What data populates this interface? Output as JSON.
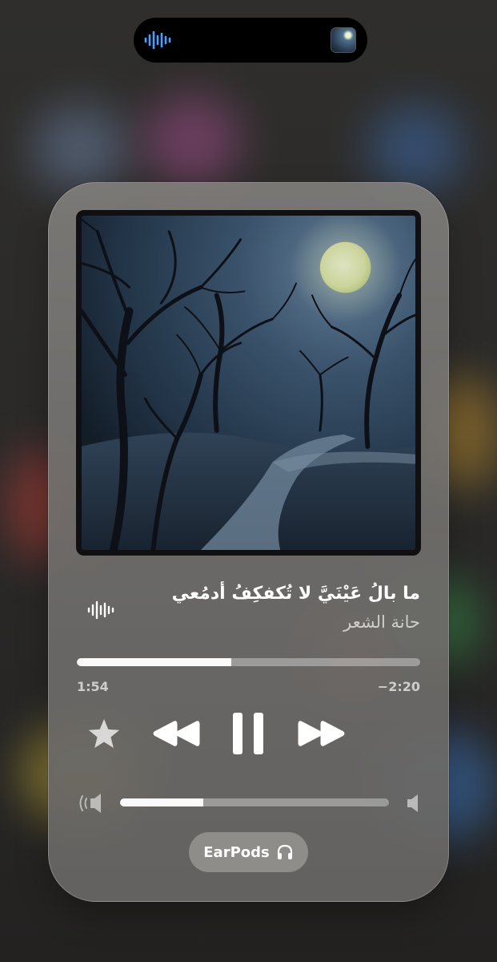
{
  "now_playing": {
    "title": "ما بالُ عَيْنَيَّ لا تُكفكِفُ أدمُعي",
    "artist": "حانة الشعر"
  },
  "playback": {
    "elapsed": "1:54",
    "remaining": "−2:20",
    "progress_fraction": 0.45,
    "is_playing": true
  },
  "volume": {
    "level_fraction": 0.31
  },
  "output": {
    "device_label": "EarPods",
    "device_icon": "headphones-icon"
  },
  "icons": {
    "island_left": "waveform-icon",
    "live_indicator": "waveform-icon",
    "favorite": "star-icon",
    "previous": "rewind-icon",
    "play_pause": "pause-icon",
    "next": "fast-forward-icon",
    "volume_low": "speaker-low-icon",
    "volume_high": "speaker-high-icon"
  },
  "colors": {
    "island_wave": "#4a9eff",
    "card_background": "#7a7876",
    "progress_fill": "#ffffff",
    "star": "#d9d8d6"
  }
}
